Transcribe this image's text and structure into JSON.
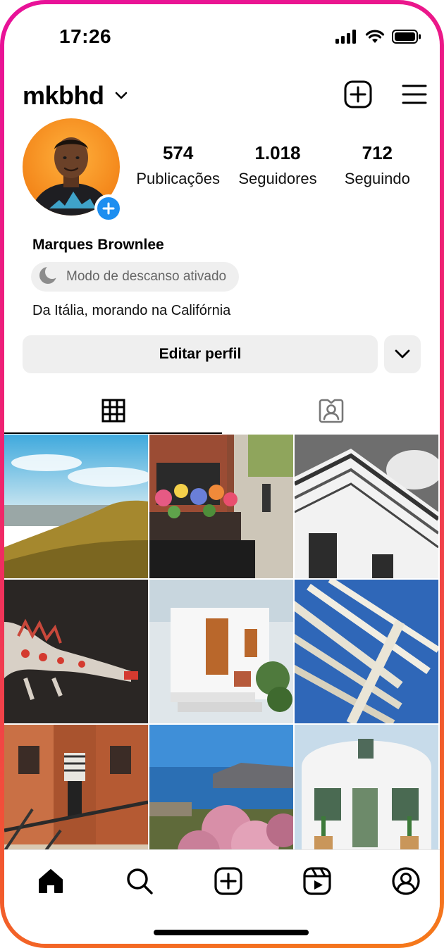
{
  "status_bar": {
    "time": "17:26"
  },
  "header": {
    "username": "mkbhd"
  },
  "profile": {
    "stats": [
      {
        "value": "574",
        "label": "Publicações"
      },
      {
        "value": "1.018",
        "label": "Seguidores"
      },
      {
        "value": "712",
        "label": "Seguindo"
      }
    ],
    "name": "Marques Brownlee",
    "rest_mode": "Modo de descanso ativado",
    "bio": "Da Itália, morando na Califórnia"
  },
  "actions": {
    "edit_profile": "Editar perfil"
  },
  "colors": {
    "accent_blue": "#1d8ef0",
    "button_bg": "#efefef",
    "frame_gradient_start": "#e8119a",
    "frame_gradient_end": "#f57a1a"
  },
  "icons": {
    "header": [
      "chevron-down-icon",
      "new-post-icon",
      "menu-icon"
    ],
    "tabs": [
      "grid-icon",
      "tagged-icon"
    ],
    "nav": [
      "home-icon",
      "search-icon",
      "create-icon",
      "reels-icon",
      "profile-icon"
    ]
  }
}
